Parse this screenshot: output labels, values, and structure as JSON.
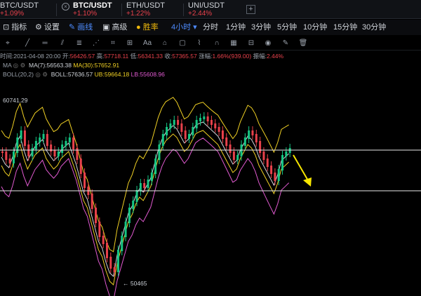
{
  "pairs": [
    {
      "symbol": "BTC/USDT",
      "change": "+1.09%",
      "active": false
    },
    {
      "symbol": "BTC/USDT",
      "change": "+1.10%",
      "active": true
    },
    {
      "symbol": "ETH/USDT",
      "change": "+1.22%",
      "active": false
    },
    {
      "symbol": "UNI/USDT",
      "change": "+2.44%",
      "active": false
    }
  ],
  "add_tab": "+",
  "toolbar": {
    "indicators": "指标",
    "settings": "设置",
    "draw": "画线",
    "advanced": "高级",
    "winrate": "胜率",
    "timeframe_selected": "4小时 ▾",
    "timeframes": [
      "分时",
      "1分钟",
      "3分钟",
      "5分钟",
      "10分钟",
      "15分钟",
      "30分钟"
    ]
  },
  "ohlc": {
    "time_label": "时间:",
    "time": "2021-04-08 20:00",
    "open_label": "开:",
    "open": "56426.57",
    "high_label": "高:",
    "high": "57718.11",
    "low_label": "低:",
    "low": "56341.33",
    "close_label": "收:",
    "close": "57365.57",
    "change_label": "涨幅:",
    "change": "1.66%(939.00)",
    "amp_label": "振幅:",
    "amp": "2.44%"
  },
  "ma": {
    "name": "MA",
    "ma7_label": "MA(7):",
    "ma7": "56563.38",
    "ma30_label": "MA(30):",
    "ma30": "57652.91"
  },
  "boll": {
    "name": "BOLL(20,2)",
    "boll_label": "BOLL:",
    "boll": "57636.57",
    "ub_label": "UB:",
    "ub": "59664.18",
    "lb_label": "LB:",
    "lb": "55608.96"
  },
  "chart_data": {
    "type": "candlestick",
    "high_marker": "60741.29",
    "low_marker": "← 50465",
    "support_line": "horizontal",
    "resistance_line": "horizontal",
    "arrow_direction": "down-right",
    "colors": {
      "up": "#16c784",
      "down": "#e8414b",
      "ma7": "#d0d4da",
      "ma30": "#f0d024",
      "ub": "#f0d024",
      "lb": "#e05ad0",
      "arrow": "#f7e600"
    }
  }
}
